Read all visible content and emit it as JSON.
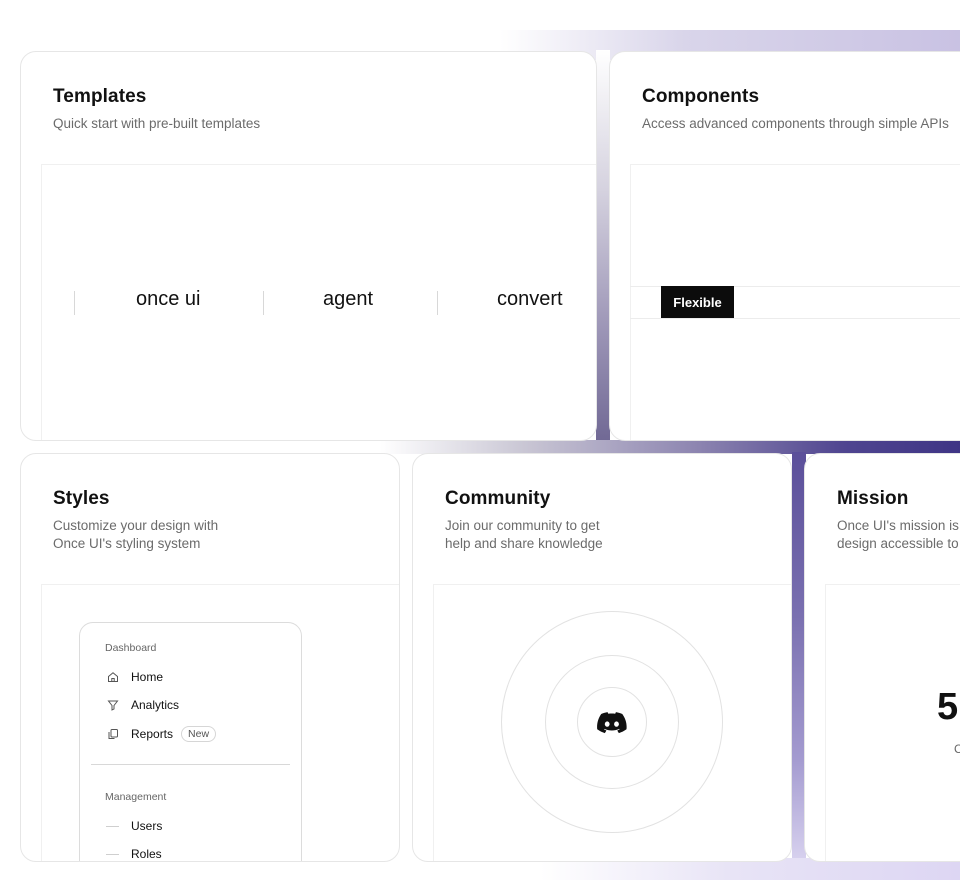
{
  "cards": {
    "templates": {
      "title": "Templates",
      "description": "Quick start with pre-built templates",
      "logos": [
        "once ui",
        "agent",
        "convert"
      ]
    },
    "components": {
      "title": "Components",
      "description": "Access advanced components through simple APIs",
      "tag": "Flexible"
    },
    "styles": {
      "title": "Styles",
      "description_lines": [
        "Customize your design with",
        "Once UI's styling system"
      ],
      "menu": {
        "section1": "Dashboard",
        "items1": [
          {
            "label": "Home",
            "icon": "home-icon"
          },
          {
            "label": "Analytics",
            "icon": "filter-icon"
          },
          {
            "label": "Reports",
            "icon": "copy-icon",
            "badge": "New"
          }
        ],
        "section2": "Management",
        "items2": [
          {
            "label": "Users"
          },
          {
            "label": "Roles"
          }
        ]
      }
    },
    "community": {
      "title": "Community",
      "description_lines": [
        "Join our community to get",
        "help and share knowledge"
      ],
      "icon": "discord-icon"
    },
    "mission": {
      "title": "Mission",
      "description_lines": [
        "Once UI's mission is",
        "design accessible to"
      ],
      "number": "5",
      "caption": "C"
    }
  }
}
